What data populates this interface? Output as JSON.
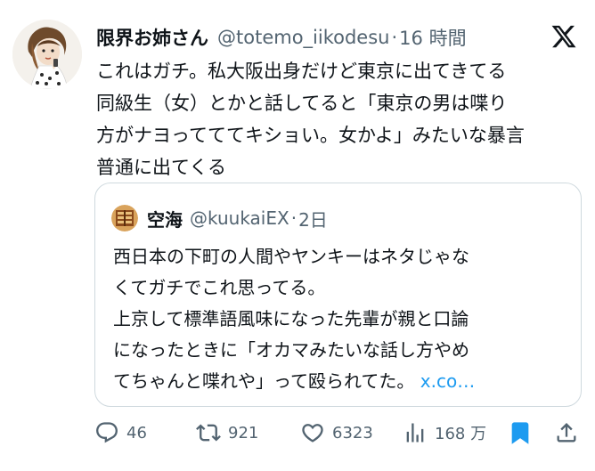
{
  "tweet": {
    "author_name": "限界お姉さん",
    "author_handle": "@totemo_iikodesu",
    "separator": "·",
    "time": "16 時間",
    "text": "これはガチ。私大阪出身だけど東京に出てきてる\n同級生（女）とかと話してると「東京の男は喋り\n方がナヨってててキショい。女かよ」みたいな暴言\n普通に出てくる"
  },
  "quote": {
    "author_name": "空海",
    "author_handle": "@kuukaiEX",
    "separator": "·",
    "time": "2日",
    "text": "西日本の下町の人間やヤンキーはネタじゃな\nくてガチでこれ思ってる。\n上京して標準語風味になった先輩が親と口論\nになったときに「オカマみたいな話し方やめ\nてちゃんと喋れや」って殴られてた。 ",
    "link": "x.co…"
  },
  "actions": {
    "replies": "46",
    "retweets": "921",
    "likes": "6323",
    "views": "168 万"
  },
  "colors": {
    "text": "#0f1419",
    "secondary": "#536471",
    "link": "#1d9bf0",
    "bookmark_active": "#1d9bf0",
    "border": "#cfd9de"
  },
  "icons": [
    "x-logo-icon",
    "reply-icon",
    "retweet-icon",
    "like-icon",
    "views-icon",
    "bookmark-icon",
    "share-icon"
  ]
}
